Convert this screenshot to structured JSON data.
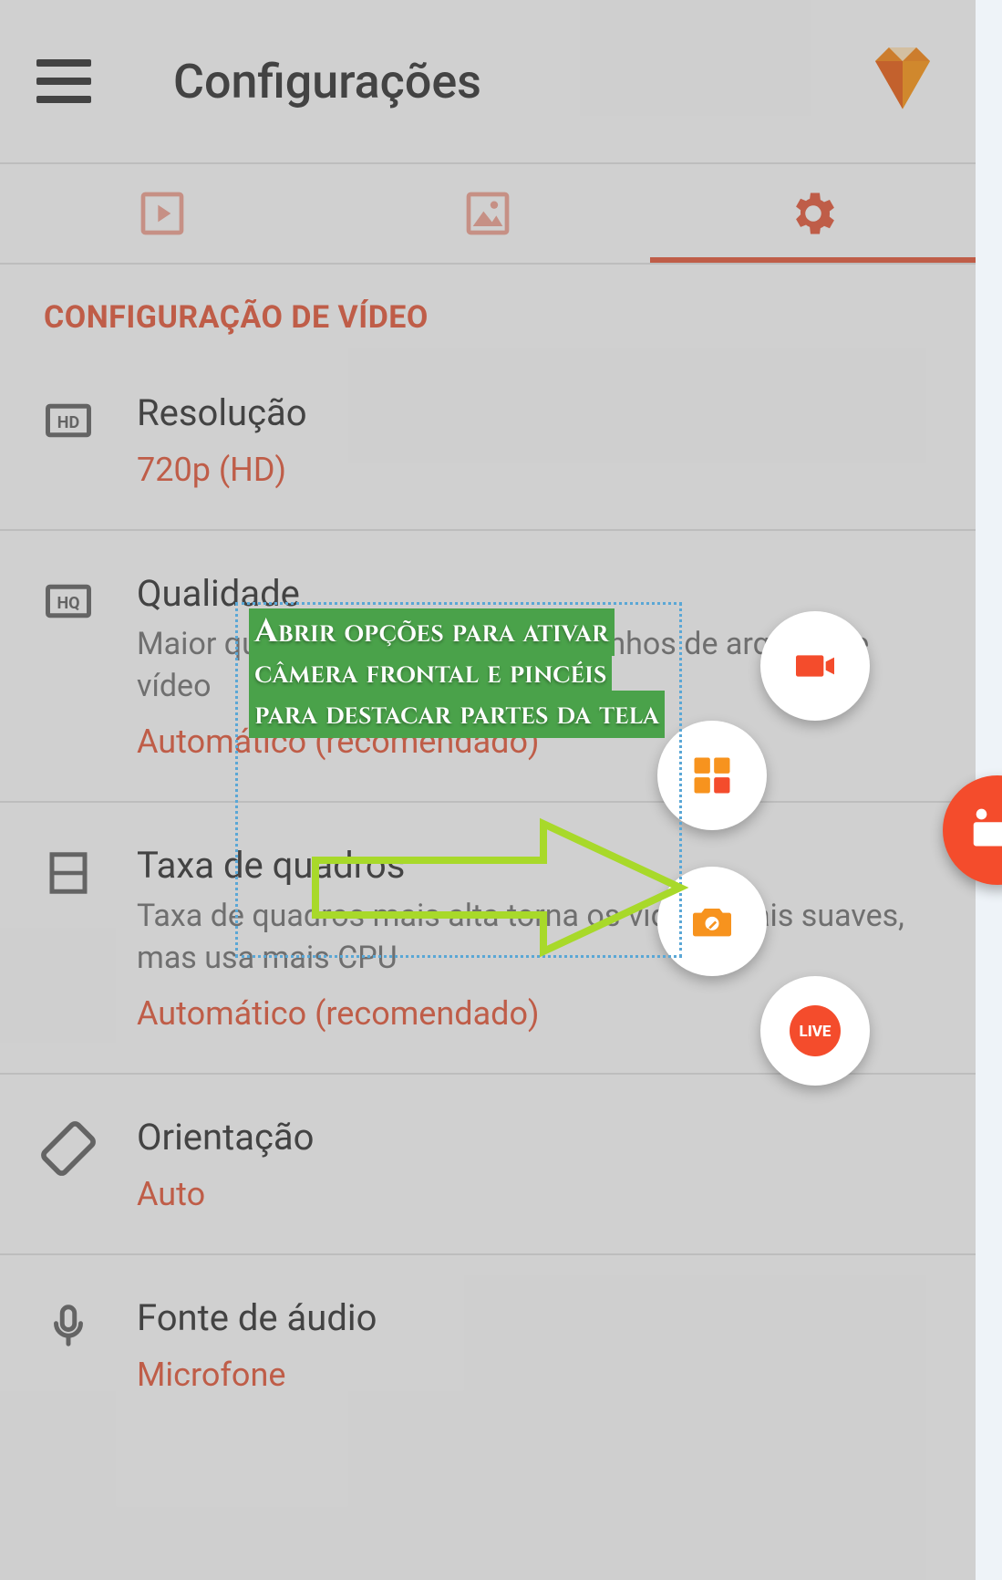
{
  "header": {
    "title": "Configurações"
  },
  "section": {
    "title": "CONFIGURAÇÃO DE VÍDEO"
  },
  "rows": {
    "resolution": {
      "title": "Resolução",
      "value": "720p (HD)"
    },
    "quality": {
      "title": "Qualidade",
      "desc": "Maior qualidade aumenta os tamanhos de arquivo de vídeo",
      "value": "Automático (recomendado)"
    },
    "framerate": {
      "title": "Taxa de quadros",
      "desc": "Taxa de quadros mais alta torna os vídeos mais suaves, mas usa mais CPU",
      "value": "Automático (recomendado)"
    },
    "orientation": {
      "title": "Orientação",
      "value": "Auto"
    },
    "audio": {
      "title": "Fonte de áudio",
      "value": "Microfone"
    }
  },
  "fab": {
    "live_label": "LIVE"
  },
  "annotation": {
    "text": "Abrir opções para ativar câmera frontal e pincéis para destacar partes da tela"
  },
  "colors": {
    "accent": "#e04b2a"
  }
}
